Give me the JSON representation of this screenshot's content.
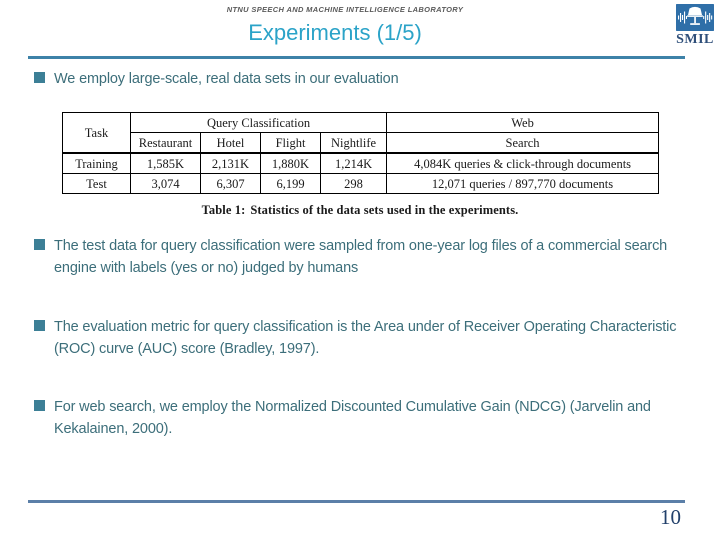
{
  "header": {
    "organization": "NTNU SPEECH AND MACHINE INTELLIGENCE LABORATORY",
    "title": "Experiments (1/5)",
    "logo_text": "SMIL",
    "logo_icon": "microphone-waveform-icon",
    "accent_color": "#2ba3c8",
    "rule_color": "#3d82a8"
  },
  "body": {
    "bullet_color": "#3c7f96",
    "text_color": "#3c6e7a",
    "bullets": [
      {
        "text": "We employ large-scale, real data sets in our evaluation"
      },
      {
        "text": "The test data for query classification were sampled from one-year log files of a commercial search engine with labels (yes or no) judged by humans"
      },
      {
        "text": "The evaluation metric for query classification is the Area under of Receiver Operating Characteristic (ROC) curve (AUC) score (Bradley, 1997)."
      },
      {
        "text": "For web search, we employ the Normalized Discounted Cumulative Gain (NDCG) (Jarvelin and Kekalainen, 2000)."
      }
    ]
  },
  "table": {
    "group_headers": {
      "task": "Task",
      "query_classification": "Query Classification",
      "web": "Web",
      "search": "Search"
    },
    "sub_headers": [
      "Restaurant",
      "Hotel",
      "Flight",
      "Nightlife"
    ],
    "rows": [
      {
        "label": "Training",
        "values": [
          "1,585K",
          "2,131K",
          "1,880K",
          "1,214K"
        ],
        "web": "4,084K queries & click-through documents"
      },
      {
        "label": "Test",
        "values": [
          "3,074",
          "6,307",
          "6,199",
          "298"
        ],
        "web": "12,071 queries / 897,770 documents"
      }
    ],
    "caption_number": "Table 1:",
    "caption_text": "Statistics of the data sets used in the experiments."
  },
  "footer": {
    "page_number": "10",
    "rule_color": "#5b7fa8"
  }
}
